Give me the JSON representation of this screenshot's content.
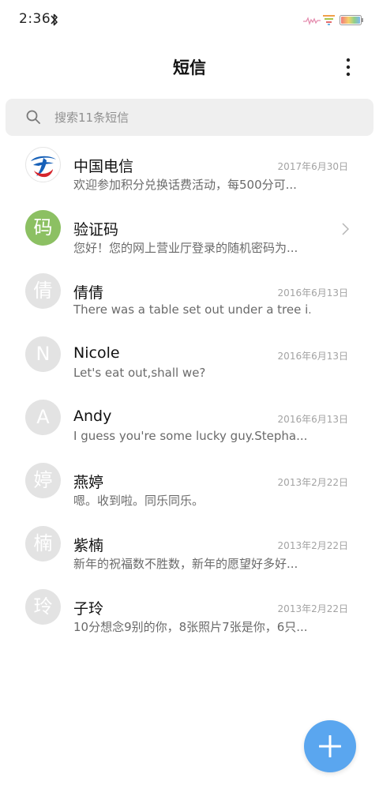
{
  "status_bar": {
    "time": "2:36",
    "icons": [
      "bluetooth-icon",
      "signal-icon",
      "wifi-icon",
      "battery-icon"
    ]
  },
  "header": {
    "title": "短信",
    "more_icon": "more-vertical-icon"
  },
  "search": {
    "placeholder": "搜索11条短信",
    "icon": "search-icon"
  },
  "conversations": [
    {
      "name": "中国电信",
      "preview": "欢迎参加积分兑换话费活动，每500分可...",
      "date": "2017年6月30日",
      "avatar_type": "logo"
    },
    {
      "name": "验证码",
      "preview": "您好！您的网上营业厅登录的随机密码为...",
      "avatar_text": "码",
      "avatar_color": "#8cc063",
      "trailing_icon": "chevron-right-icon"
    },
    {
      "name": "倩倩",
      "preview": "There was a table set out under a tree i...",
      "date": "2016年6月13日",
      "avatar_text": "倩"
    },
    {
      "name": "Nicole",
      "preview": "Let's eat out,shall we?",
      "date": "2016年6月13日",
      "avatar_text": "N"
    },
    {
      "name": "Andy",
      "preview": "I guess you're some lucky guy.Stepha...",
      "date": "2016年6月13日",
      "avatar_text": "A"
    },
    {
      "name": "燕婷",
      "preview": "嗯。收到啦。同乐同乐。",
      "date": "2013年2月22日",
      "avatar_text": "婷"
    },
    {
      "name": "紫楠",
      "preview": "新年的祝福数不胜数，新年的愿望好多好...",
      "date": "2013年2月22日",
      "avatar_text": "楠"
    },
    {
      "name": "子玲",
      "preview": "10分想念9别的你，8张照片7张是你，6只...",
      "date": "2013年2月22日",
      "avatar_text": "玲"
    }
  ],
  "fab": {
    "icon": "plus-icon",
    "color": "#5aa6ef"
  },
  "colors": {
    "accent": "#5aa6ef",
    "avatar_gray": "#e3e3e3"
  }
}
